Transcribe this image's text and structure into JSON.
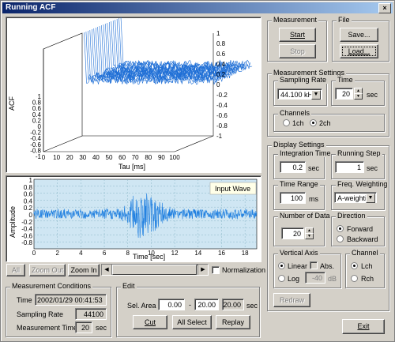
{
  "window": {
    "title": "Running ACF",
    "close_glyph": "×"
  },
  "acf_plot": {
    "ylabel": "ACF",
    "xlabel": "Tau [ms]",
    "x_ticks": [
      "0",
      "10",
      "20",
      "30",
      "40",
      "50",
      "60",
      "70",
      "80",
      "90",
      "100"
    ],
    "left_ticks": [
      "1",
      "0.8",
      "0.6",
      "0.4",
      "0.2",
      "0",
      "-0.2",
      "-0.4",
      "-0.6",
      "-0.8",
      "-1"
    ],
    "right_ticks": [
      "1",
      "0.8",
      "0.6",
      "0.4",
      "0.2",
      "0",
      "-0.2",
      "-0.4",
      "-0.6",
      "-0.8",
      "-1"
    ]
  },
  "wave_plot": {
    "ylabel": "Amplitude",
    "xlabel": "Time [sec]",
    "legend": "Input Wave",
    "x_ticks": [
      "0",
      "2",
      "4",
      "6",
      "8",
      "10",
      "12",
      "14",
      "16",
      "18"
    ],
    "y_ticks": [
      "1",
      "0.8",
      "0.6",
      "0.4",
      "0.2",
      "0",
      "-0.2",
      "-0.4",
      "-0.6",
      "-0.8"
    ],
    "line_color": "#1f7fe0",
    "bg_color": "#cfe6f3"
  },
  "zoom": {
    "all": "All",
    "zoom_out": "Zoom Out",
    "zoom_in": "Zoom In",
    "normalization": "Normalization"
  },
  "measurement_conditions": {
    "title": "Measurement Conditions",
    "time_label": "Time",
    "time_value": "2002/01/29 00:41:53",
    "rate_label": "Sampling Rate",
    "rate_value": "44100",
    "mtime_label": "Measurement Time",
    "mtime_value": "20",
    "mtime_unit": "sec"
  },
  "edit": {
    "title": "Edit",
    "sel_area_label": "Sel. Area",
    "from": "0.00",
    "dash": "-",
    "to": "20.00",
    "len": "20.00",
    "unit": "sec",
    "cut": "Cut",
    "all_select": "All Select",
    "replay": "Replay"
  },
  "measurement": {
    "title": "Measurement",
    "start": "Start",
    "stop": "Stop"
  },
  "file": {
    "title": "File",
    "save": "Save...",
    "load": "Load..."
  },
  "measurement_settings": {
    "title": "Measurement Settings",
    "sampling_rate_label": "Sampling Rate",
    "sampling_rate_value": "44.100 kHz",
    "time_label": "Time",
    "time_value": "20",
    "time_unit": "sec",
    "channels_label": "Channels",
    "ch1": "1ch",
    "ch2": "2ch"
  },
  "display_settings": {
    "title": "Display Settings",
    "integration_label": "Integration Time",
    "integration_value": "0.2",
    "integration_unit": "sec",
    "running_step_label": "Running Step",
    "running_step_value": "1",
    "running_step_unit": "sec",
    "time_range_label": "Time Range",
    "time_range_value": "100",
    "time_range_unit": "ms",
    "freq_weighting_label": "Freq. Weighting",
    "freq_weighting_value": "A-weighting",
    "num_data_label": "Number of Data",
    "num_data_value": "20",
    "direction_label": "Direction",
    "forward": "Forward",
    "backward": "Backward",
    "vertical_axis_label": "Vertical Axis",
    "linear": "Linear",
    "abs": "Abs.",
    "log": "Log",
    "log_value": "-40",
    "log_unit": "dB",
    "channel_label": "Channel",
    "lch": "Lch",
    "rch": "Rch",
    "redraw": "Redraw"
  },
  "exit": "Exit"
}
